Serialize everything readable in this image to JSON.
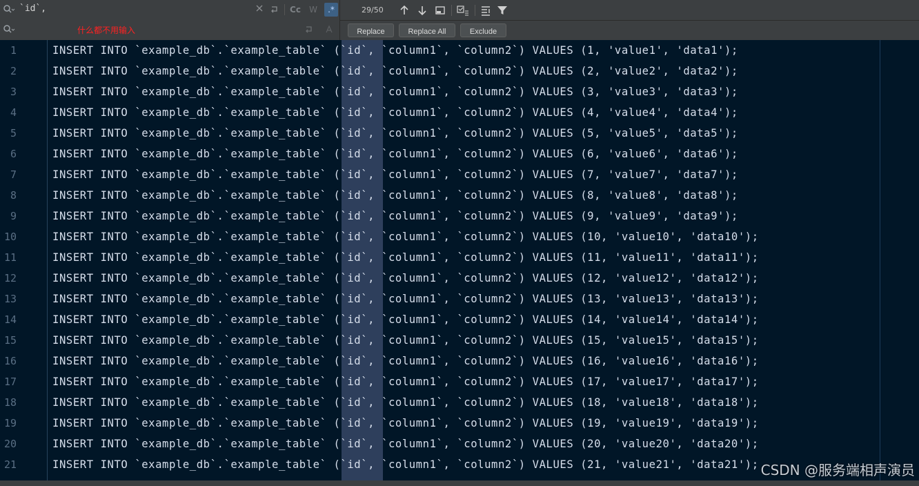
{
  "find": {
    "search_value": "`id`,",
    "replace_hint": "什么都不用输入",
    "case_label": "Cc",
    "word_label": "W",
    "regex_label": ".*",
    "match_count": "29/50"
  },
  "replace_buttons": {
    "replace": "Replace",
    "replace_all": "Replace All",
    "exclude": "Exclude"
  },
  "editor": {
    "lines": [
      {
        "n": "1",
        "text": "INSERT INTO `example_db`.`example_table` (`id`, `column1`, `column2`) VALUES (1, 'value1', 'data1');"
      },
      {
        "n": "2",
        "text": "INSERT INTO `example_db`.`example_table` (`id`, `column1`, `column2`) VALUES (2, 'value2', 'data2');"
      },
      {
        "n": "3",
        "text": "INSERT INTO `example_db`.`example_table` (`id`, `column1`, `column2`) VALUES (3, 'value3', 'data3');"
      },
      {
        "n": "4",
        "text": "INSERT INTO `example_db`.`example_table` (`id`, `column1`, `column2`) VALUES (4, 'value4', 'data4');"
      },
      {
        "n": "5",
        "text": "INSERT INTO `example_db`.`example_table` (`id`, `column1`, `column2`) VALUES (5, 'value5', 'data5');"
      },
      {
        "n": "6",
        "text": "INSERT INTO `example_db`.`example_table` (`id`, `column1`, `column2`) VALUES (6, 'value6', 'data6');"
      },
      {
        "n": "7",
        "text": "INSERT INTO `example_db`.`example_table` (`id`, `column1`, `column2`) VALUES (7, 'value7', 'data7');"
      },
      {
        "n": "8",
        "text": "INSERT INTO `example_db`.`example_table` (`id`, `column1`, `column2`) VALUES (8, 'value8', 'data8');"
      },
      {
        "n": "9",
        "text": "INSERT INTO `example_db`.`example_table` (`id`, `column1`, `column2`) VALUES (9, 'value9', 'data9');"
      },
      {
        "n": "10",
        "text": "INSERT INTO `example_db`.`example_table` (`id`, `column1`, `column2`) VALUES (10, 'value10', 'data10');"
      },
      {
        "n": "11",
        "text": "INSERT INTO `example_db`.`example_table` (`id`, `column1`, `column2`) VALUES (11, 'value11', 'data11');"
      },
      {
        "n": "12",
        "text": "INSERT INTO `example_db`.`example_table` (`id`, `column1`, `column2`) VALUES (12, 'value12', 'data12');"
      },
      {
        "n": "13",
        "text": "INSERT INTO `example_db`.`example_table` (`id`, `column1`, `column2`) VALUES (13, 'value13', 'data13');"
      },
      {
        "n": "14",
        "text": "INSERT INTO `example_db`.`example_table` (`id`, `column1`, `column2`) VALUES (14, 'value14', 'data14');"
      },
      {
        "n": "15",
        "text": "INSERT INTO `example_db`.`example_table` (`id`, `column1`, `column2`) VALUES (15, 'value15', 'data15');"
      },
      {
        "n": "16",
        "text": "INSERT INTO `example_db`.`example_table` (`id`, `column1`, `column2`) VALUES (16, 'value16', 'data16');"
      },
      {
        "n": "17",
        "text": "INSERT INTO `example_db`.`example_table` (`id`, `column1`, `column2`) VALUES (17, 'value17', 'data17');"
      },
      {
        "n": "18",
        "text": "INSERT INTO `example_db`.`example_table` (`id`, `column1`, `column2`) VALUES (18, 'value18', 'data18');"
      },
      {
        "n": "19",
        "text": "INSERT INTO `example_db`.`example_table` (`id`, `column1`, `column2`) VALUES (19, 'value19', 'data19');"
      },
      {
        "n": "20",
        "text": "INSERT INTO `example_db`.`example_table` (`id`, `column1`, `column2`) VALUES (20, 'value20', 'data20');"
      },
      {
        "n": "21",
        "text": "INSERT INTO `example_db`.`example_table` (`id`, `column1`, `column2`) VALUES (21, 'value21', 'data21');"
      }
    ]
  },
  "watermark": "CSDN @服务端相声演员",
  "colors": {
    "editor_bg": "#011627",
    "toolbar_bg": "#3c3f41",
    "match_highlight": "#2e3f5c",
    "hint_red": "#ff2222",
    "code_text": "#d6deeb"
  },
  "icons": [
    "search-icon",
    "clear-icon",
    "history-icon",
    "regex-icon",
    "arrow-up-icon",
    "arrow-down-icon",
    "select-all-icon",
    "in-selection-icon",
    "filter-icon"
  ]
}
